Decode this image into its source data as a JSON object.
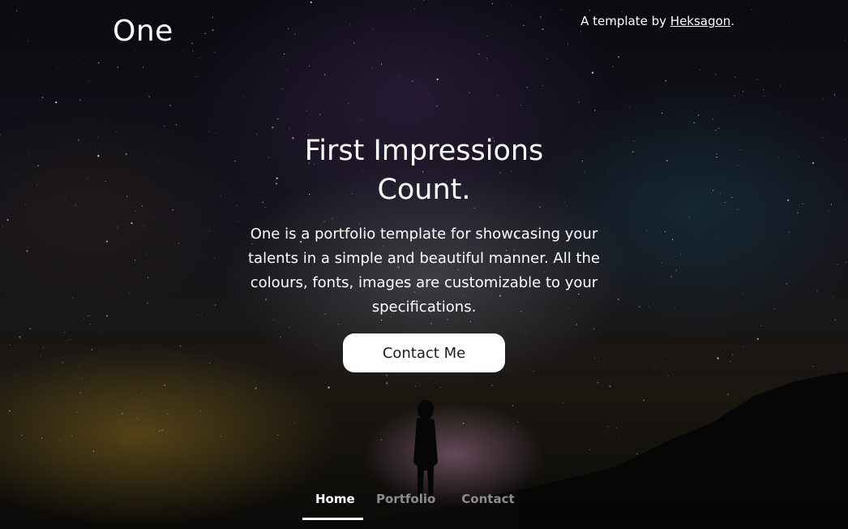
{
  "header": {
    "logo": "One",
    "credit_prefix": "A template by",
    "credit_link": "Heksagon",
    "credit_suffix": "."
  },
  "hero": {
    "headline": "First Impressions Count.",
    "description": "One is a portfolio template for showcasing your talents in a simple and beautiful manner. All the colours, fonts, images are customizable to your specifications.",
    "cta_label": "Contact Me"
  },
  "nav": {
    "items": [
      {
        "label": "Home",
        "active": true
      },
      {
        "label": "Portfolio",
        "active": false
      },
      {
        "label": "Contact",
        "active": false
      }
    ]
  },
  "colors": {
    "text": "#ffffff",
    "button_bg": "#ffffff",
    "button_text": "#1c1c1c",
    "nav_inactive": "#8d8d8d"
  },
  "background_image": "night sky with milky way and silhouette of person on hillside"
}
